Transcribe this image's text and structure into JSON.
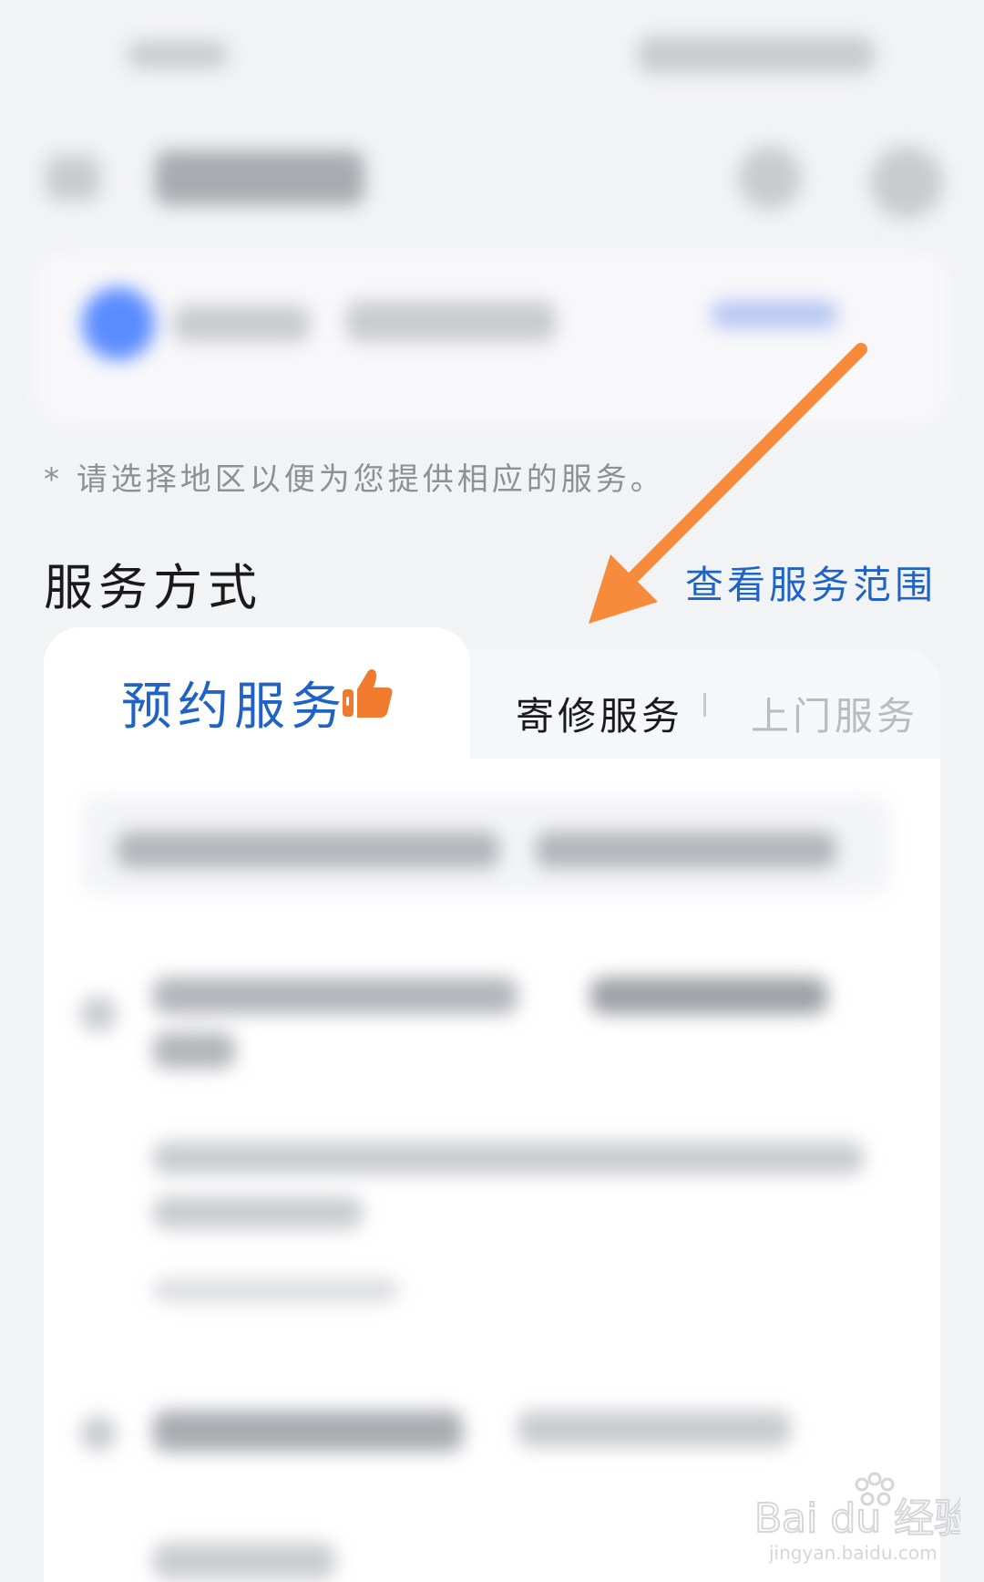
{
  "hint_text": "* 请选择地区以便为您提供相应的服务。",
  "service_section": {
    "title": "服务方式",
    "range_link": "查看服务范围"
  },
  "tabs": [
    {
      "label": "预约服务",
      "active": true,
      "badge_icon": "thumbs-up-icon"
    },
    {
      "label": "寄修服务",
      "active": false
    },
    {
      "label": "上门服务",
      "active": false
    }
  ],
  "colors": {
    "accent_blue": "#1f63c6",
    "thumb_orange": "#f07a2e",
    "arrow_orange": "#f68b3c",
    "background": "#f2f3f5"
  },
  "watermark": {
    "brand": "Bai du 经验",
    "url": "jingyan.baidu.com"
  }
}
